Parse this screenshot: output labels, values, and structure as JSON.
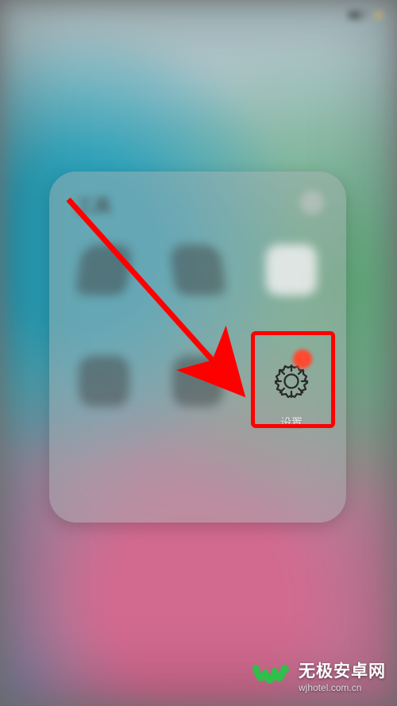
{
  "status": {
    "left": "",
    "time": "",
    "battery_pct": ""
  },
  "folder": {
    "title": "工具",
    "apps": [
      {
        "label": ""
      },
      {
        "label": ""
      },
      {
        "label": ""
      },
      {
        "label": ""
      },
      {
        "label": ""
      },
      {
        "label": "设置"
      }
    ]
  },
  "highlight": {
    "target_index": 5
  },
  "watermark": {
    "title": "无极安卓网",
    "subtitle": "wjhotel.com.cn"
  }
}
